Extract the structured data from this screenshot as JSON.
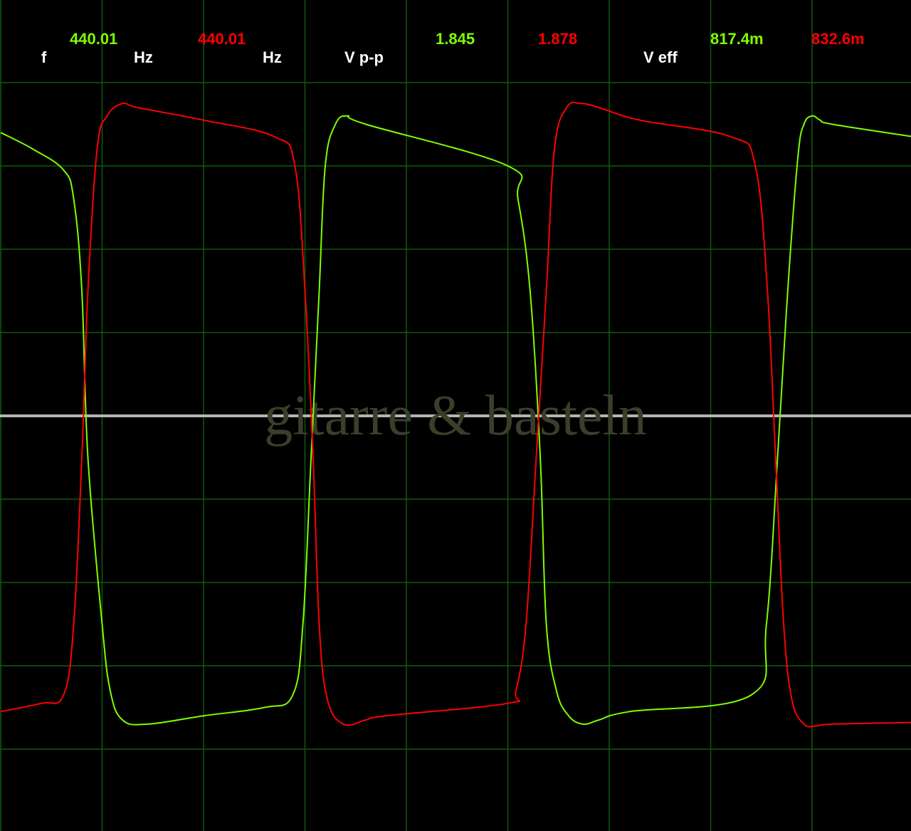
{
  "readouts": {
    "f_label": "f",
    "f_ch1": "440.01",
    "f_unit1": "Hz",
    "f_ch2": "440.01",
    "f_unit2": "Hz",
    "vpp_label": "V p-p",
    "vpp_ch1": "1.845",
    "vpp_ch2": "1.878",
    "veff_label": "V eff",
    "veff_ch1": "817.4m",
    "veff_ch2": "832.6m"
  },
  "watermark": "gitarre & basteln",
  "colors": {
    "background": "#000000",
    "grid": "#0f5a0f",
    "ch1": "#7fff00",
    "ch2": "#ff0000",
    "baseline": "#b4b4b4",
    "label": "#ffffff"
  },
  "chart_data": {
    "type": "line",
    "title": "",
    "xlabel": "",
    "ylabel": "",
    "grid": true,
    "x_unit": "division",
    "y_unit": "division",
    "xlim": [
      0,
      9
    ],
    "ylim": [
      -4,
      5
    ],
    "series": [
      {
        "name": "ch1",
        "color": "#7fff00",
        "x": [
          0.0,
          0.32,
          0.62,
          0.72,
          0.8,
          0.86,
          1.0,
          1.08,
          1.2,
          1.45,
          2.0,
          2.6,
          2.88,
          2.98,
          3.06,
          3.14,
          3.2,
          3.3,
          3.42,
          3.6,
          5.0,
          5.1,
          5.22,
          5.32,
          5.38,
          5.48,
          5.6,
          5.74,
          5.9,
          6.2,
          7.4,
          7.55,
          7.66,
          7.76,
          7.86,
          7.92,
          8.0,
          8.08,
          8.2,
          9.0
        ],
        "y": [
          3.4,
          3.2,
          2.95,
          2.6,
          1.5,
          -0.5,
          -2.5,
          -3.3,
          -3.65,
          -3.7,
          -3.6,
          -3.5,
          -3.35,
          -2.5,
          -0.5,
          1.5,
          3.0,
          3.5,
          3.6,
          3.5,
          3.0,
          2.6,
          1.5,
          -0.5,
          -2.5,
          -3.3,
          -3.6,
          -3.7,
          -3.65,
          -3.55,
          -3.35,
          -2.5,
          -0.5,
          1.5,
          3.1,
          3.5,
          3.6,
          3.55,
          3.5,
          3.35
        ]
      },
      {
        "name": "ch2",
        "color": "#ff0000",
        "x": [
          0.0,
          0.4,
          0.62,
          0.72,
          0.8,
          0.86,
          0.95,
          1.05,
          1.2,
          1.35,
          2.0,
          2.7,
          2.9,
          3.0,
          3.08,
          3.14,
          3.22,
          3.38,
          3.6,
          3.8,
          5.0,
          5.08,
          5.18,
          5.28,
          5.38,
          5.46,
          5.58,
          5.72,
          5.9,
          6.3,
          7.2,
          7.44,
          7.56,
          7.64,
          7.72,
          7.8,
          7.92,
          8.05,
          8.2,
          9.0
        ],
        "y": [
          -3.55,
          -3.45,
          -3.35,
          -2.5,
          -0.5,
          1.5,
          3.2,
          3.6,
          3.75,
          3.7,
          3.55,
          3.35,
          3.0,
          1.5,
          -0.5,
          -2.5,
          -3.4,
          -3.7,
          -3.65,
          -3.6,
          -3.45,
          -3.3,
          -2.5,
          -0.5,
          1.5,
          3.2,
          3.7,
          3.75,
          3.7,
          3.55,
          3.35,
          3.0,
          1.5,
          -0.5,
          -2.5,
          -3.4,
          -3.7,
          -3.72,
          -3.7,
          -3.68
        ]
      }
    ]
  }
}
